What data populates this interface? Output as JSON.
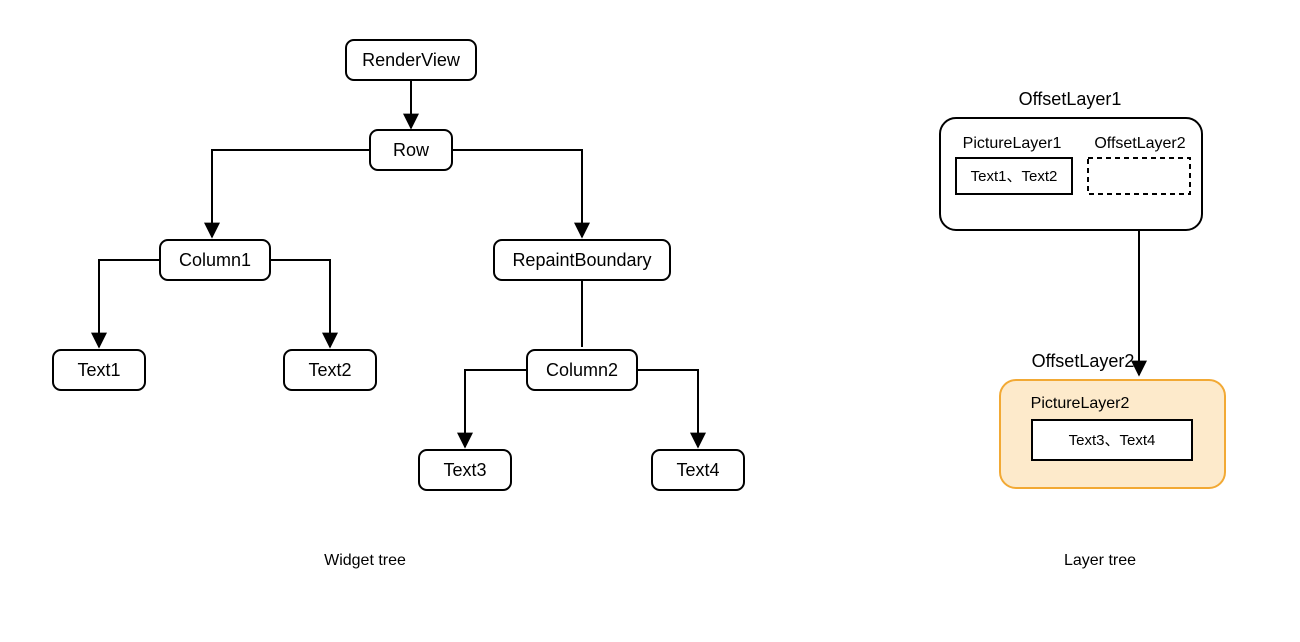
{
  "widget_tree": {
    "render_view": "RenderView",
    "row": "Row",
    "column1": "Column1",
    "repaint_boundary": "RepaintBoundary",
    "text1": "Text1",
    "text2": "Text2",
    "column2": "Column2",
    "text3": "Text3",
    "text4": "Text4",
    "caption": "Widget tree"
  },
  "layer_tree": {
    "offset_layer1": "OffsetLayer1",
    "picture_layer1": "PictureLayer1",
    "offset_layer2_inner": "OffsetLayer2",
    "text12": "Text1、Text2",
    "offset_layer2_bottom": "OffsetLayer2",
    "picture_layer2": "PictureLayer2",
    "text34": "Text3、Text4",
    "caption": "Layer tree"
  },
  "colors": {
    "highlight_fill": "#fdeacb",
    "highlight_stroke": "#f2a934"
  }
}
